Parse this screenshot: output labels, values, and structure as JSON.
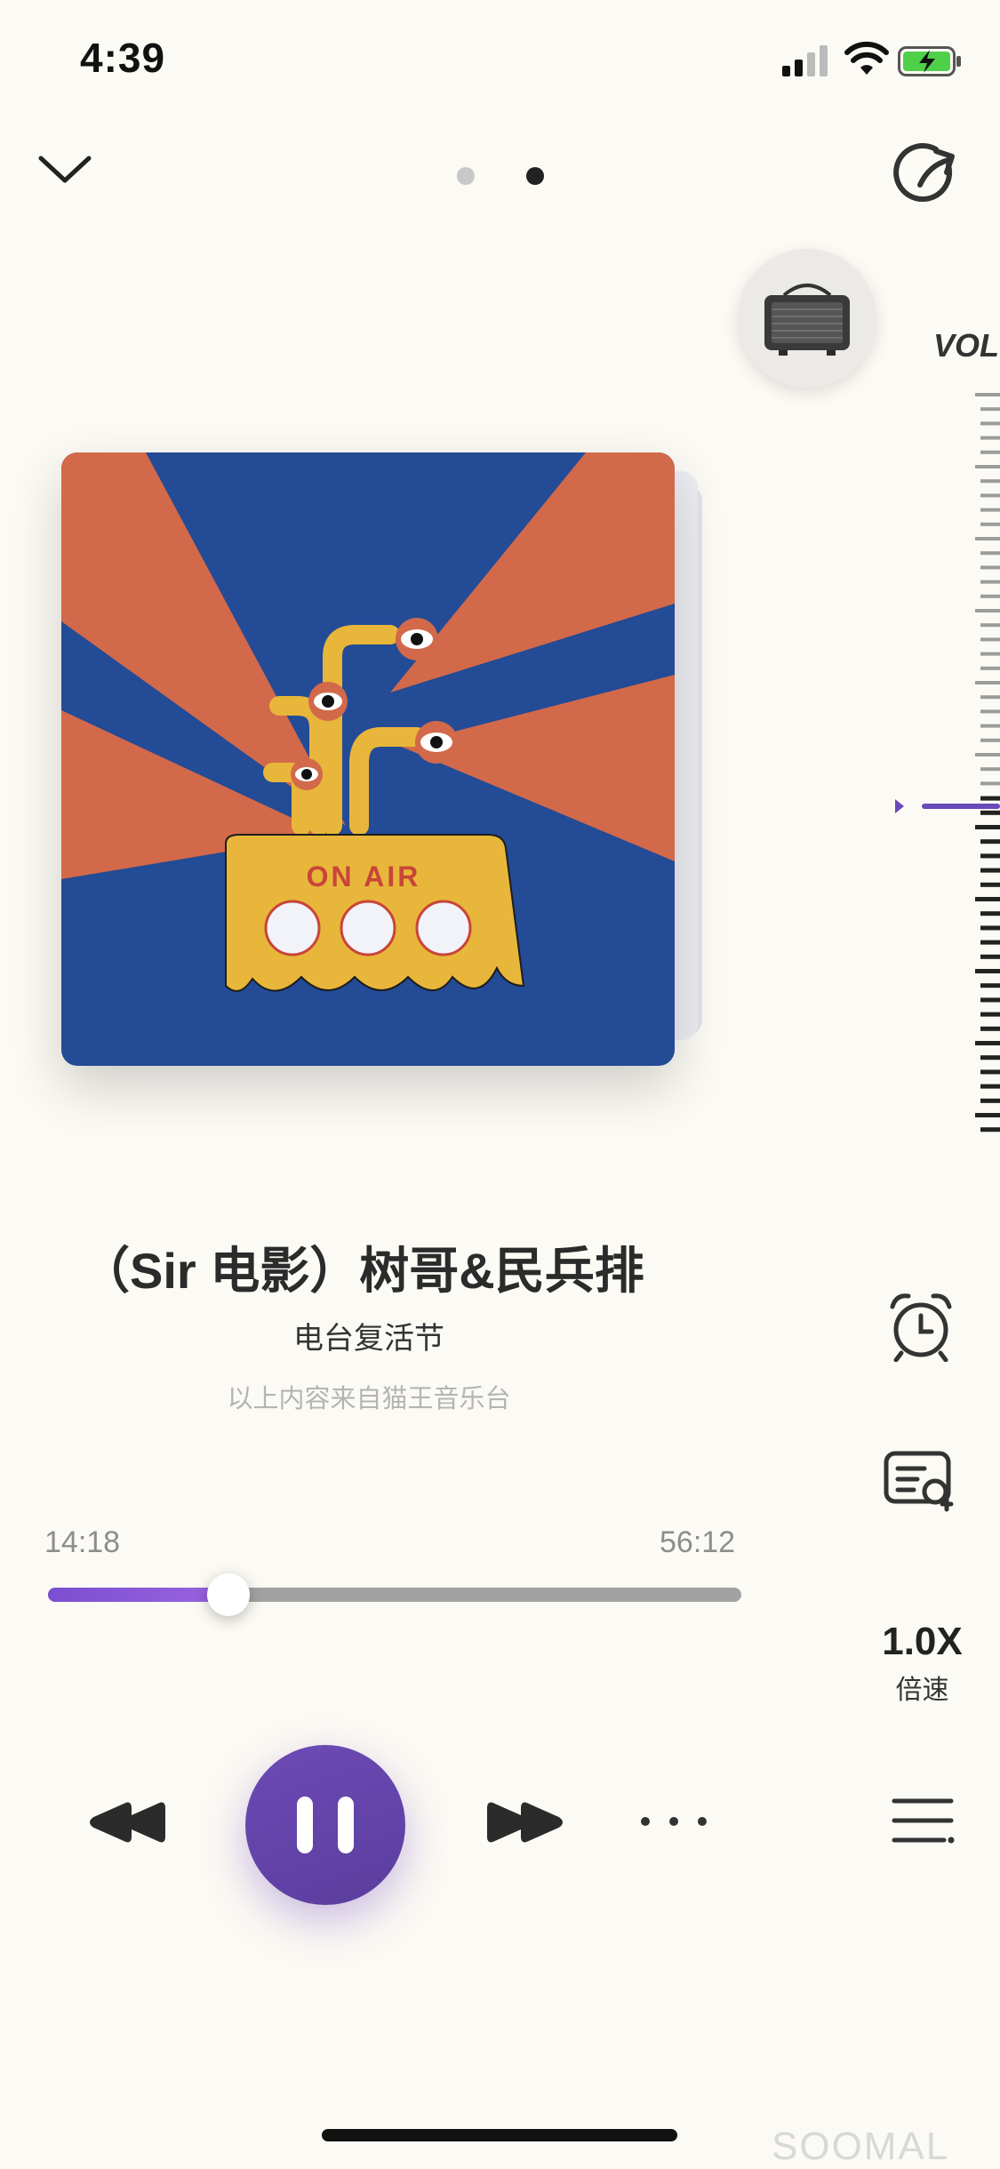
{
  "status_bar": {
    "time": "4:39"
  },
  "header": {
    "page_count": 2,
    "active_page": 2
  },
  "device": {
    "volume_label": "VOL"
  },
  "album_art": {
    "caption": "ON AIR"
  },
  "track": {
    "title": "（Sir 电影）树哥&民兵排",
    "subtitle": "电台复活节",
    "source": "以上内容来自猫王音乐台"
  },
  "progress": {
    "current": "14:18",
    "total": "56:12",
    "fraction": 0.26
  },
  "speed": {
    "value": "1.0X",
    "label": "倍速"
  },
  "watermark": "SOOMAL",
  "colors": {
    "accent": "#6a49b8",
    "progress_fill": "#8a58d8",
    "background": "#fcfaf4"
  }
}
